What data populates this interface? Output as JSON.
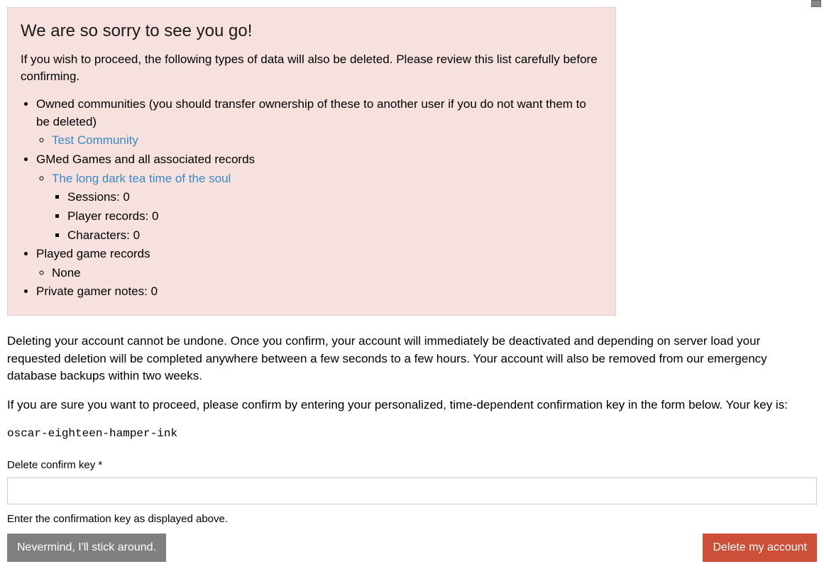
{
  "warning": {
    "heading": "We are so sorry to see you go!",
    "intro": "If you wish to proceed, the following types of data will also be deleted. Please review this list carefully before confirming.",
    "items": {
      "owned_communities_label": "Owned communities (you should transfer ownership of these to another user if you do not want them to be deleted)",
      "community_link": "Test Community",
      "gmed_games_label": "GMed Games and all associated records",
      "game_link": "The long dark tea time of the soul",
      "sessions": "Sessions: 0",
      "player_records": "Player records: 0",
      "characters": "Characters: 0",
      "played_game_records_label": "Played game records",
      "played_none": "None",
      "private_notes": "Private gamer notes: 0"
    }
  },
  "body": {
    "para1": "Deleting your account cannot be undone. Once you confirm, your account will immediately be deactivated and depending on server load your requested deletion will be completed anywhere between a few seconds to a few hours. Your account will also be removed from our emergency database backups within two weeks.",
    "para2": "If you are sure you want to proceed, please confirm by entering your personalized, time-dependent confirmation key in the form below. Your key is:"
  },
  "key": "oscar-eighteen-hamper-ink",
  "form": {
    "label": "Delete confirm key *",
    "help": "Enter the confirmation key as displayed above.",
    "cancel_button": "Nevermind, I'll stick around.",
    "delete_button": "Delete my account"
  }
}
